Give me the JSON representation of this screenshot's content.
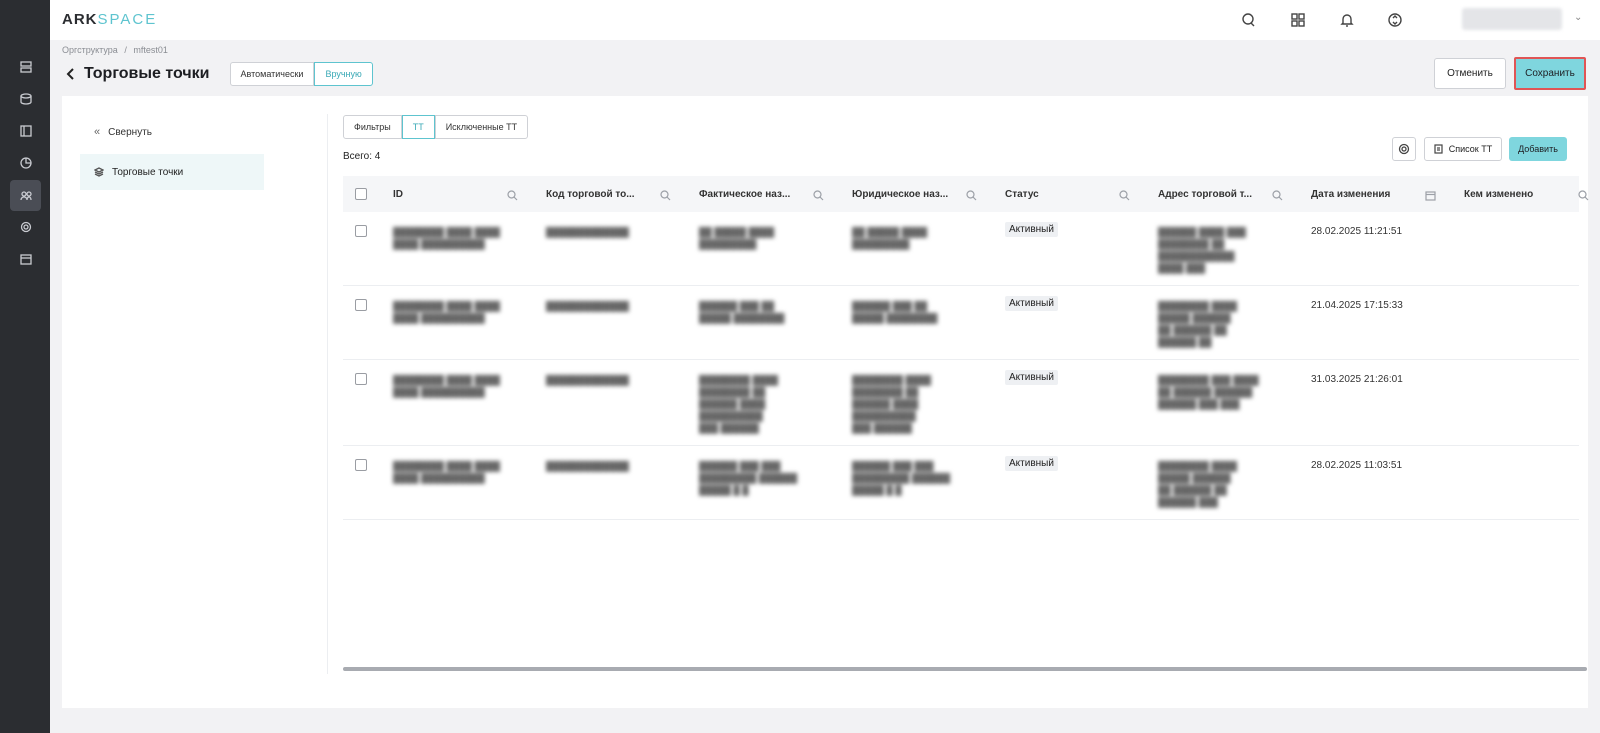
{
  "app": {
    "logo_primary": "ARK",
    "logo_secondary": "SPACE"
  },
  "header": {
    "icons": [
      "chat-icon",
      "apps-grid-icon",
      "bell-icon",
      "sync-icon"
    ],
    "user_caret": "⌄"
  },
  "breadcrumb": {
    "items": [
      "Оргструктура",
      "/",
      "mftest01"
    ]
  },
  "title_row": {
    "title": "Торговые точки",
    "mode_options": [
      "Автоматически",
      "Вручную"
    ],
    "mode_selected": "Вручную"
  },
  "actions": {
    "cancel_label": "Отменить",
    "save_label": "Сохранить"
  },
  "sidebar": {
    "collapse_label": "Свернуть",
    "items": [
      {
        "label": "Торговые точки",
        "icon": "layers-icon"
      }
    ]
  },
  "tabs": {
    "items": [
      "Фильтры",
      "ТТ",
      "Исключенные ТТ"
    ],
    "selected": "ТТ"
  },
  "summary": {
    "total_label": "Всего: 4"
  },
  "toolbar": {
    "list_label": "Список ТТ",
    "add_label": "Добавить"
  },
  "table": {
    "columns": [
      "ID",
      "Код торговой то...",
      "Фактическое наз...",
      "Юридическое наз...",
      "Статус",
      "Адрес торговой т...",
      "Дата изменения",
      "Кем изменено"
    ],
    "rows": [
      {
        "status": "Активный",
        "date": "28.02.2025 11:21:51"
      },
      {
        "status": "Активный",
        "date": "21.04.2025 17:15:33"
      },
      {
        "status": "Активный",
        "date": "31.03.2025 21:26:01"
      },
      {
        "status": "Активный",
        "date": "28.02.2025 11:03:51"
      }
    ]
  },
  "colors": {
    "accent": "#5ec4cf",
    "save_highlight": "#e05555",
    "rail": "#2b2d31"
  }
}
